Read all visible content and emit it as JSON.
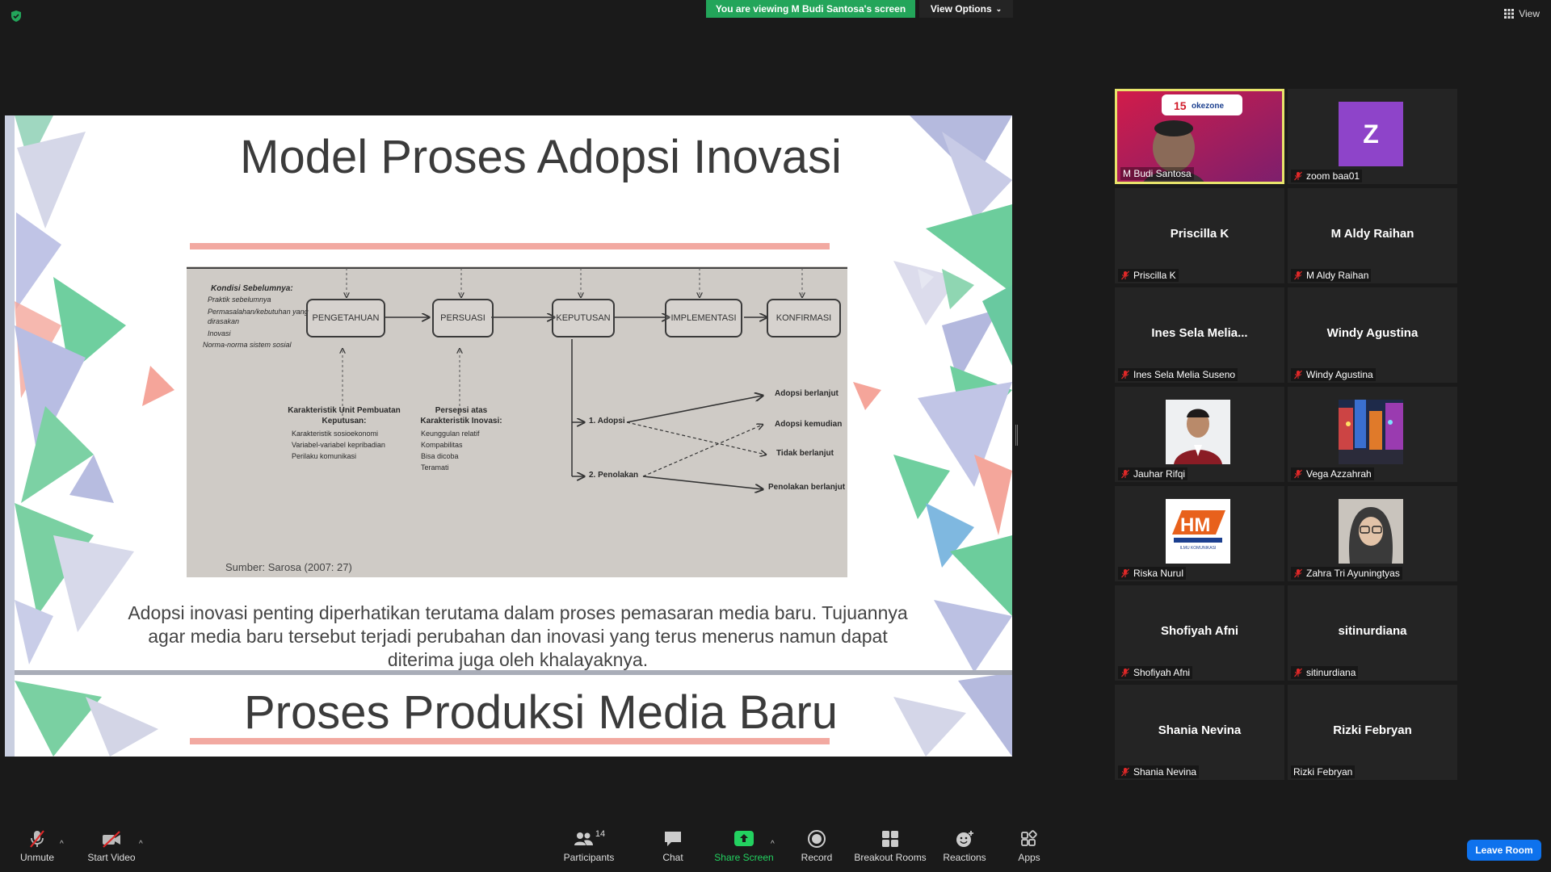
{
  "top": {
    "viewing_banner": "You are viewing M Budi Santosa's screen",
    "view_options": "View Options",
    "view_label": "View"
  },
  "slide": {
    "title": "Model Proses Adopsi Inovasi",
    "body": "Adopsi inovasi penting diperhatikan terutama dalam proses pemasaran media baru. Tujuannya agar media baru tersebut terjadi perubahan dan inovasi yang terus menerus namun dapat diterima juga oleh khalayaknya.",
    "next_title": "Proses Produksi Media Baru",
    "diagram": {
      "kondisi_title": "Kondisi Sebelumnya:",
      "kondisi_items": [
        "Praktik sebelumnya",
        "Permasalahan/kebutuhan yang dirasakan",
        "Inovasi",
        "Norma-norma sistem sosial"
      ],
      "stages": [
        "PENGETAHUAN",
        "PERSUASI",
        "KEPUTUSAN",
        "IMPLEMENTASI",
        "KONFIRMASI"
      ],
      "unit_title": "Karakteristik Unit Pembuatan Keputusan:",
      "unit_items": [
        "Karakteristik sosioekonomi",
        "Variabel-variabel kepribadian",
        "Perilaku komunikasi"
      ],
      "persepsi_title": "Persepsi atas Karakteristik Inovasi:",
      "persepsi_items": [
        "Keunggulan relatif",
        "Kompabilitas",
        "Bisa dicoba",
        "Teramati"
      ],
      "adopsi": "1. Adopsi",
      "penolakan": "2. Penolakan",
      "outcomes": [
        "Adopsi berlanjut",
        "Adopsi kemudian",
        "Tidak berlanjut",
        "Penolakan berlanjut"
      ],
      "source": "Sumber: Sarosa (2007: 27)"
    }
  },
  "participants": [
    {
      "center": "",
      "label": "M Budi Santosa",
      "muted": false,
      "kind": "video",
      "active": true
    },
    {
      "center": "Z",
      "label": "zoom baa01",
      "muted": true,
      "kind": "avatar-z"
    },
    {
      "center": "Priscilla K",
      "label": "Priscilla K",
      "muted": true,
      "kind": "name"
    },
    {
      "center": "M Aldy Raihan",
      "label": "M Aldy Raihan",
      "muted": true,
      "kind": "name"
    },
    {
      "center": "Ines Sela Melia...",
      "label": "Ines Sela Melia Suseno",
      "muted": true,
      "kind": "name"
    },
    {
      "center": "Windy Agustina",
      "label": "Windy Agustina",
      "muted": true,
      "kind": "name"
    },
    {
      "center": "",
      "label": "Jauhar Rifqi",
      "muted": true,
      "kind": "photo-jauhar"
    },
    {
      "center": "",
      "label": "Vega Azzahrah",
      "muted": true,
      "kind": "photo-vega"
    },
    {
      "center": "",
      "label": "Riska Nurul",
      "muted": true,
      "kind": "photo-riska"
    },
    {
      "center": "",
      "label": "Zahra Tri Ayuningtyas",
      "muted": true,
      "kind": "photo-zahra"
    },
    {
      "center": "Shofiyah Afni",
      "label": "Shofiyah Afni",
      "muted": true,
      "kind": "name"
    },
    {
      "center": "sitinurdiana",
      "label": "sitinurdiana",
      "muted": true,
      "kind": "name"
    },
    {
      "center": "Shania Nevina",
      "label": "Shania Nevina",
      "muted": true,
      "kind": "name"
    },
    {
      "center": "Rizki Febryan",
      "label": "Rizki Febryan",
      "muted": false,
      "kind": "name"
    }
  ],
  "toolbar": {
    "unmute": "Unmute",
    "start_video": "Start Video",
    "participants": "Participants",
    "participants_count": "14",
    "chat": "Chat",
    "share_screen": "Share Screen",
    "record": "Record",
    "breakout": "Breakout Rooms",
    "reactions": "Reactions",
    "apps": "Apps",
    "leave": "Leave Room"
  },
  "colors": {
    "banner_green": "#23a55a",
    "leave_blue": "#0e72ed",
    "active_border": "#e8e46b",
    "avatar_purple": "#8e44c9"
  }
}
